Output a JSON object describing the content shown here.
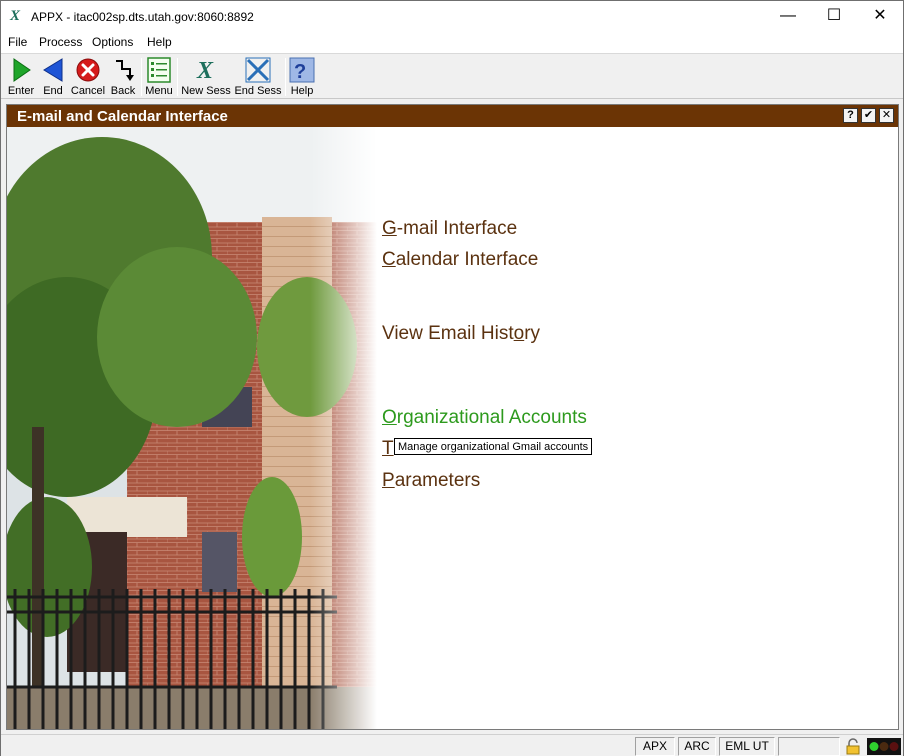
{
  "window": {
    "title": "APPX - itac002sp.dts.utah.gov:8060:8892",
    "app_icon": "X",
    "controls": {
      "minimize": "—",
      "maximize": "☐",
      "close": "✕"
    }
  },
  "menubar": [
    "File",
    "Process",
    "Options",
    "Help"
  ],
  "toolbar": {
    "enter": "Enter",
    "end": "End",
    "cancel": "Cancel",
    "back": "Back",
    "menu": "Menu",
    "new_sess": "New Sess",
    "end_sess": "End Sess",
    "help": "Help"
  },
  "frame": {
    "title": "E-mail and Calendar Interface",
    "buttons": {
      "help": "?",
      "ok": "✔",
      "close": "✕"
    }
  },
  "options": [
    {
      "hotkey": "G",
      "rest": "-mail Interface"
    },
    {
      "hotkey": "C",
      "rest": "alendar Interface"
    },
    {
      "before": "View Email Hist",
      "hotkey": "o",
      "after": "ry"
    },
    {
      "hotkey": "O",
      "rest": "rganizational Accounts"
    },
    {
      "hotkey": "T",
      "rest": ""
    },
    {
      "hotkey": "P",
      "rest": "arameters"
    }
  ],
  "tooltip": "Manage organizational Gmail accounts",
  "statusbar": {
    "apx": "APX",
    "arc": "ARC",
    "eml": "EML UT"
  },
  "colors": {
    "frame_header": "#6b3405",
    "option_text": "#5b3210",
    "option_hover": "#2d9a1d"
  }
}
